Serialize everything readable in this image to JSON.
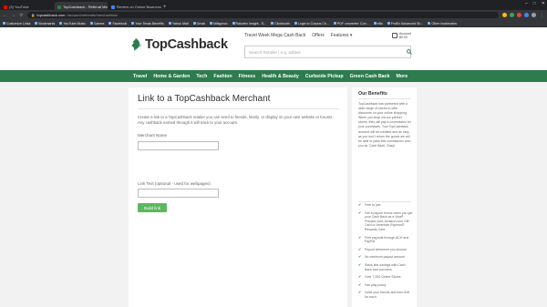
{
  "browser": {
    "tabs": [
      {
        "label": "(3) YouTube",
        "color": "#ff0000",
        "active": false
      },
      {
        "label": "TopCashback - Referral Merchan",
        "color": "#2c7c4d",
        "active": true
      },
      {
        "label": "Review on Online Business",
        "color": "#4285f4",
        "active": false
      }
    ],
    "new_tab_symbol": "+",
    "window_controls": [
      "–",
      "□",
      "✕"
    ],
    "back_symbol": "←",
    "forward_symbol": "→",
    "reload_symbol": "⟳",
    "url_host": "topcashback.com",
    "url_path": "/account/referrals/merchantlink/",
    "lock_symbol": "🔒",
    "extension_colors": [
      "#fbbc05",
      "#34a853",
      "#ea4335",
      "#4285f4",
      "#9aa0a6"
    ],
    "menu_symbol": "⋮",
    "bookmarks": [
      "Customize Links",
      "Bookmarks",
      "YouTube Music",
      "Games",
      "Facebook",
      "Your Texas Benefits",
      "Yahoo Mail",
      "Gmail",
      "Milagreco",
      "Rakuten Insight - S...",
      "Clickbooth",
      "Login to Corpus Ch...",
      "PDF converter: Con...",
      "eBs",
      "FedEx Advanced Sh...",
      "Other bookmarks"
    ]
  },
  "site": {
    "logo_text": "TopCashback",
    "top_links": [
      "Travel Week Mega Cash Back",
      "Offers",
      "Features ▾"
    ],
    "account_label": "Account",
    "account_balance": "$0.00",
    "search_placeholder": "Search Retailer | e.g. adidas",
    "nav": [
      "Travel",
      "Home & Garden",
      "Tech",
      "Fashion",
      "Fitness",
      "Health & Beauty",
      "Curbside Pickup",
      "Green Cash Back",
      "More"
    ]
  },
  "main": {
    "title": "Link to a TopCashback Merchant",
    "description": "Create a link to a TopCashback retailer you can send to friends, family, or display on your own website or forums. Any cashback earned through it will track to your account.",
    "merchant_label": "Merchant Name",
    "link_text_label": "Link Text (optional - used for webpages)",
    "build_button": "Build link"
  },
  "sidebar": {
    "title": "Our Benefits",
    "blurb": "TopCashback has partnered with a wide range of stores to offer discounts on your online shopping. When you shop via our partner stores, they will pay a commission for your purchases. Your TopCashback account will be credited and as long as you don't return the goods we will be able to pass this commission onto you as 'Cash Back'. Easy!",
    "benefits": [
      "Free to join",
      "Get a payout bonus when you get your Cash Back as a Visa® Prepaid card, Amazon.com Gift Card or American Express® Rewards Card",
      "Free payouts through ACH and PayPal",
      "Payout whenever you choose",
      "No minimum payout amount",
      "Stack tine savings with Cash Back and vouchers",
      "Over 7,000 Online Stores",
      "Fair play policy",
      "Invite your friends and earn $15 for each"
    ]
  }
}
